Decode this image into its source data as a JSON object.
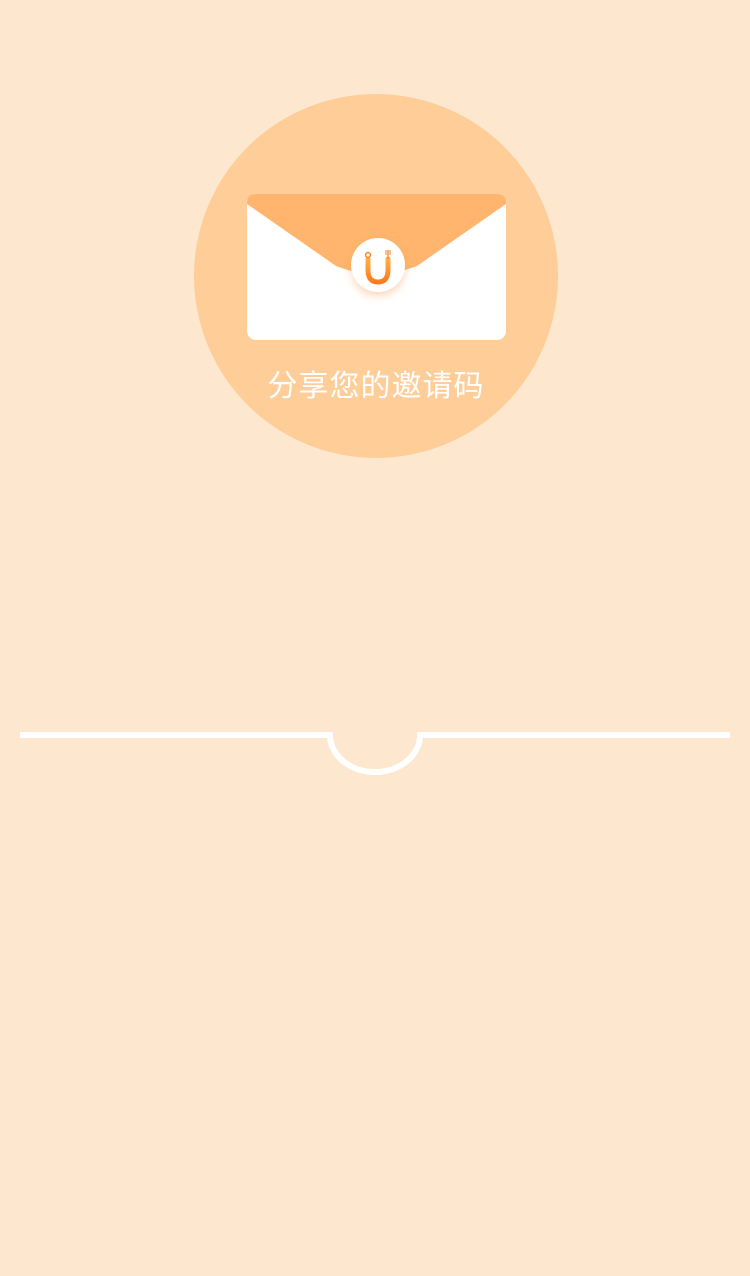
{
  "invite": {
    "title": "分享您的邀请码",
    "envelope_icon": "envelope-icon",
    "logo_icon": "u-utensils-logo-icon"
  },
  "divider": {
    "icon": "semicircle-notch"
  },
  "colors": {
    "background": "#FEE7CF",
    "circle": "#FECD98",
    "envelope_flap": "#FFB56D",
    "envelope_body": "#FFFFFF",
    "logo_orange": "#FF8A2E",
    "divider_line": "#FFFFFF"
  }
}
